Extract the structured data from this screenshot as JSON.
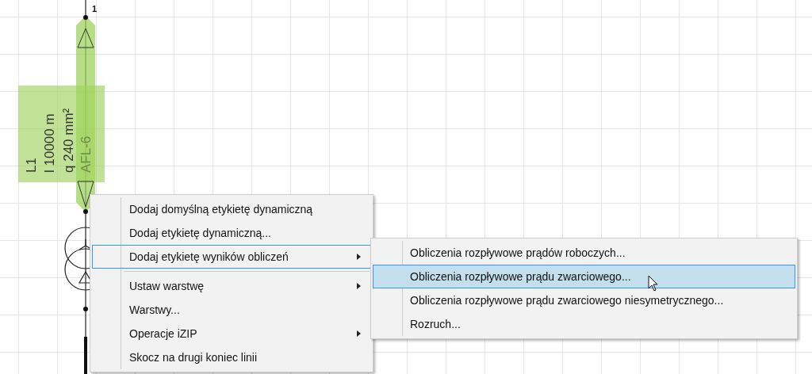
{
  "diagram": {
    "node_label": "1",
    "line_label": [
      "L1",
      "l 10000 m",
      "q 240 mm²",
      "AFL-6"
    ]
  },
  "context_menu": {
    "items": [
      {
        "kind": "item",
        "label": "Dodaj domyślną etykietę dynamiczną",
        "selected": false,
        "submenu": false
      },
      {
        "kind": "item",
        "label": "Dodaj etykietę dynamiczną...",
        "selected": false,
        "submenu": false
      },
      {
        "kind": "item",
        "label": "Dodaj etykietę wyników obliczeń",
        "selected": true,
        "submenu": true
      },
      {
        "kind": "separator"
      },
      {
        "kind": "item",
        "label": "Ustaw warstwę",
        "selected": false,
        "submenu": true
      },
      {
        "kind": "item",
        "label": "Warstwy...",
        "selected": false,
        "submenu": false
      },
      {
        "kind": "item",
        "label": "Operacje iZIP",
        "selected": false,
        "submenu": true
      },
      {
        "kind": "item",
        "label": "Skocz na drugi koniec linii",
        "selected": false,
        "submenu": false
      }
    ]
  },
  "submenu": {
    "items": [
      {
        "label": "Obliczenia rozpływowe prądów roboczych...",
        "selected": false
      },
      {
        "label": "Obliczenia rozpływowe prądu zwarciowego...",
        "selected": true
      },
      {
        "label": "Obliczenia rozpływowe prądu zwarciowego niesymetrycznego...",
        "selected": false
      },
      {
        "label": "Rozruch...",
        "selected": false
      }
    ]
  }
}
